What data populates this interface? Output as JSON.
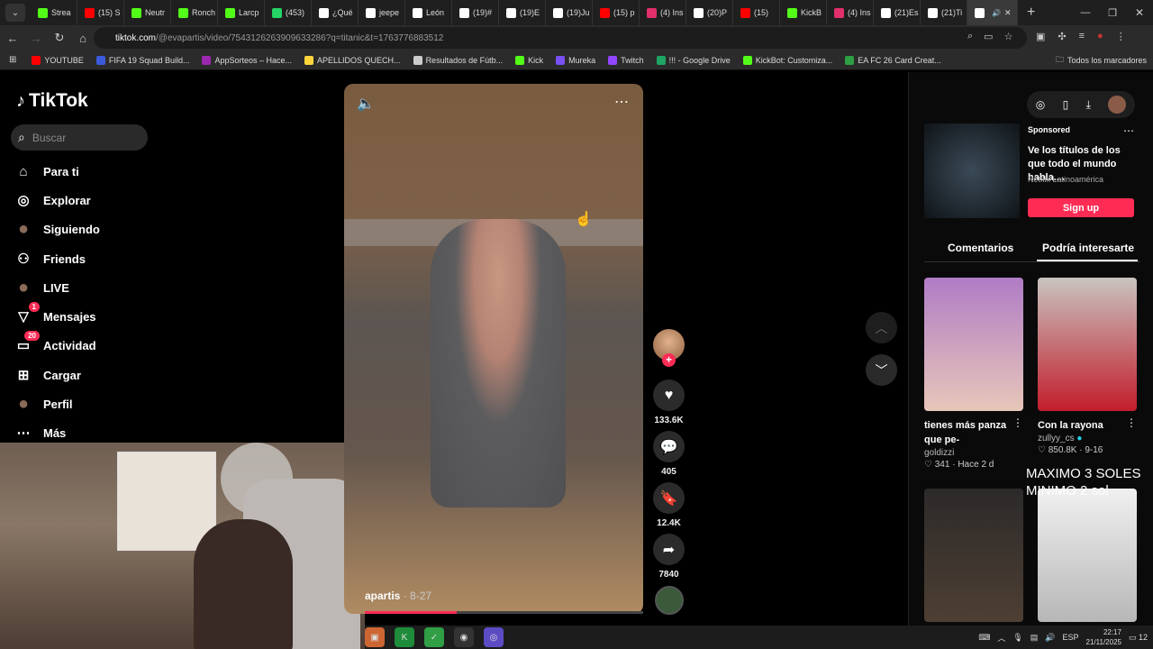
{
  "browser": {
    "tabs": [
      {
        "label": "Strea",
        "color": "#53fc18"
      },
      {
        "label": "(15) S",
        "color": "#ff0000"
      },
      {
        "label": "Neutr",
        "color": "#53fc18"
      },
      {
        "label": "Ronch",
        "color": "#53fc18"
      },
      {
        "label": "Larcp",
        "color": "#53fc18"
      },
      {
        "label": "(453)",
        "color": "#25d366"
      },
      {
        "label": "¿Qué",
        "color": "#ffffff"
      },
      {
        "label": "jeepe",
        "color": "#ffffff"
      },
      {
        "label": "León",
        "color": "#ffffff"
      },
      {
        "label": "(19)#",
        "color": "#ffffff"
      },
      {
        "label": "(19)E",
        "color": "#ffffff"
      },
      {
        "label": "(19)Ju",
        "color": "#ffffff"
      },
      {
        "label": "(15) p",
        "color": "#ff0000"
      },
      {
        "label": "(4) Ins",
        "color": "#e1306c"
      },
      {
        "label": "(20)P",
        "color": "#ffffff"
      },
      {
        "label": "(15)",
        "color": "#ff0000"
      },
      {
        "label": "KickB",
        "color": "#53fc18"
      },
      {
        "label": "(4) Ins",
        "color": "#e1306c"
      },
      {
        "label": "(21)Es",
        "color": "#ffffff"
      },
      {
        "label": "(21)Ti",
        "color": "#ffffff"
      },
      {
        "label": "",
        "color": "#ffffff",
        "active": true
      }
    ],
    "url_host": "tiktok.com",
    "url_path": "/@evapartis/video/7543126263909633286?q=titanic&t=1763776883512",
    "bookmarks": [
      {
        "label": "YOUTUBE",
        "color": "#ff0000"
      },
      {
        "label": "FIFA 19 Squad Build...",
        "color": "#3b5bdb"
      },
      {
        "label": "AppSorteos – Hace...",
        "color": "#9c27b0"
      },
      {
        "label": "APELLIDOS QUECH...",
        "color": "#ffd43b"
      },
      {
        "label": "Resultados de Fútb...",
        "color": "#cccccc"
      },
      {
        "label": "Kick",
        "color": "#53fc18"
      },
      {
        "label": "Mureka",
        "color": "#7950f2"
      },
      {
        "label": "Twitch",
        "color": "#9146ff"
      },
      {
        "label": "!!! - Google Drive",
        "color": "#1fa463"
      },
      {
        "label": "KickBot: Customiza...",
        "color": "#53fc18"
      },
      {
        "label": "EA FC 26 Card Creat...",
        "color": "#2f9e44"
      }
    ],
    "all_bookmarks": "Todos los marcadores"
  },
  "sidebar": {
    "logo": "TikTok",
    "search_placeholder": "Buscar",
    "items": [
      {
        "label": "Para ti",
        "icon": "home-icon"
      },
      {
        "label": "Explorar",
        "icon": "compass-icon"
      },
      {
        "label": "Siguiendo",
        "icon": "following-avatar-icon"
      },
      {
        "label": "Friends",
        "icon": "friends-icon"
      },
      {
        "label": "LIVE",
        "icon": "live-icon"
      },
      {
        "label": "Mensajes",
        "icon": "messages-icon",
        "badge": "1"
      },
      {
        "label": "Actividad",
        "icon": "activity-icon",
        "badge": "20"
      },
      {
        "label": "Cargar",
        "icon": "upload-icon"
      },
      {
        "label": "Perfil",
        "icon": "profile-avatar-icon"
      },
      {
        "label": "Más",
        "icon": "more-icon"
      }
    ]
  },
  "video": {
    "author": "apartis",
    "date": "· 8-27",
    "progress": 0.33,
    "likes": "133.6K",
    "comments": "405",
    "saves": "12.4K",
    "shares": "7840"
  },
  "ad": {
    "sponsored": "Sponsored",
    "title": "Ve los títulos de los que todo el mundo habla....",
    "source": "Netflix Latinoamérica",
    "cta": "Sign up"
  },
  "tabs_right": {
    "comments": "Comentarios",
    "suggested": "Podría interesarte"
  },
  "suggested": [
    {
      "title": "tienes más panza que pe-",
      "user": "goldizzi",
      "stats": "♡ 341 · Hace 2 d",
      "colors": [
        "#b07cc6",
        "#e7c7b9"
      ]
    },
    {
      "title": "Con la rayona",
      "user": "zullyy_cs",
      "stats": "♡ 850.8K · 9-16",
      "colors": [
        "#c8c4c0",
        "#c21d2c"
      ]
    },
    {
      "colors": [
        "#2c2a2a",
        "#4e3f33"
      ]
    },
    {
      "colors": [
        "#f0f0f0",
        "#b7b7b7"
      ]
    }
  ],
  "overlay_text": "MAXIMO 3 SOLES MINIMO 2 sol",
  "taskbar": {
    "lang": "ESP",
    "time": "22:17",
    "date": "21/11/2025",
    "notifications": "12"
  }
}
